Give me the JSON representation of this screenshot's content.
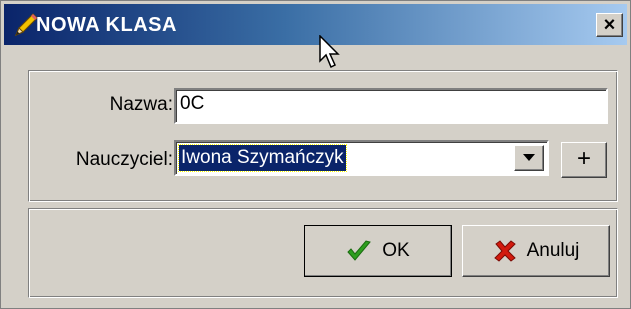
{
  "window": {
    "title": "NOWA KLASA",
    "close_label": "×"
  },
  "form": {
    "name_label": "Nazwa:",
    "name_value": "0C",
    "teacher_label": "Nauczyciel:",
    "teacher_value": "Iwona Szymańczyk",
    "add_label": "+"
  },
  "buttons": {
    "ok_label": "OK",
    "cancel_label": "Anuluj"
  },
  "icons": {
    "title": "pencil-icon",
    "ok": "checkmark-icon",
    "cancel": "red-x-icon",
    "dropdown": "triangle-down-icon"
  },
  "colors": {
    "title_start": "#0a246a",
    "title_end": "#a6caf0",
    "selection": "#0a246a",
    "ok_check": "#2e9e1f",
    "cancel_x": "#d21a0e"
  }
}
